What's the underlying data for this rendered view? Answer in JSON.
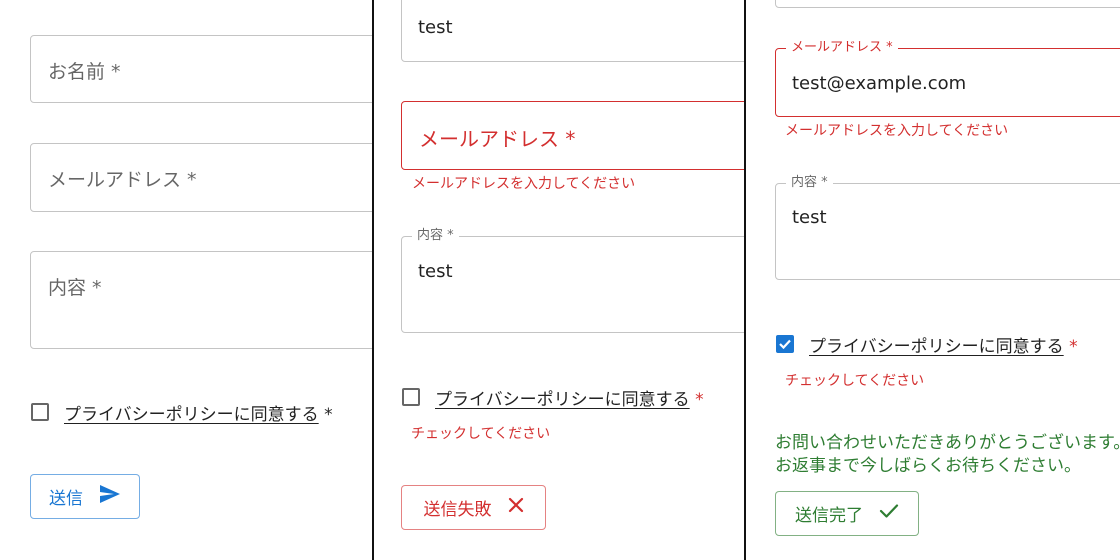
{
  "colors": {
    "primary": "#1976d2",
    "error": "#d32f2f",
    "success": "#2e7d32",
    "border": "rgba(0,0,0,0.23)"
  },
  "panel_initial": {
    "name_field": {
      "label": "お名前 *"
    },
    "email_field": {
      "label": "メールアドレス *"
    },
    "content_field": {
      "label": "内容 *"
    },
    "privacy": {
      "label": "プライバシーポリシーに同意する",
      "required_mark": "*",
      "checked": false
    },
    "submit_button": {
      "label": "送信",
      "icon": "send-icon"
    }
  },
  "panel_failed": {
    "name_field": {
      "value": "test"
    },
    "email_field": {
      "label": "メールアドレス *",
      "helper": "メールアドレスを入力してください"
    },
    "content_field": {
      "label": "内容 *",
      "value": "test"
    },
    "privacy": {
      "label": "プライバシーポリシーに同意する",
      "required_mark": "*",
      "checked": false,
      "helper": "チェックしてください"
    },
    "submit_button": {
      "label": "送信失敗",
      "icon": "close-icon"
    }
  },
  "panel_success": {
    "email_field": {
      "label": "メールアドレス *",
      "value": "test@example.com",
      "helper": "メールアドレスを入力してください"
    },
    "content_field": {
      "label": "内容 *",
      "value": "test"
    },
    "privacy": {
      "label": "プライバシーポリシーに同意する",
      "required_mark": "*",
      "checked": true,
      "helper": "チェックしてください"
    },
    "message": {
      "line1": "お問い合わせいただきありがとうございます。",
      "line2": "お返事まで今しばらくお待ちください。"
    },
    "submit_button": {
      "label": "送信完了",
      "icon": "check-icon"
    }
  }
}
